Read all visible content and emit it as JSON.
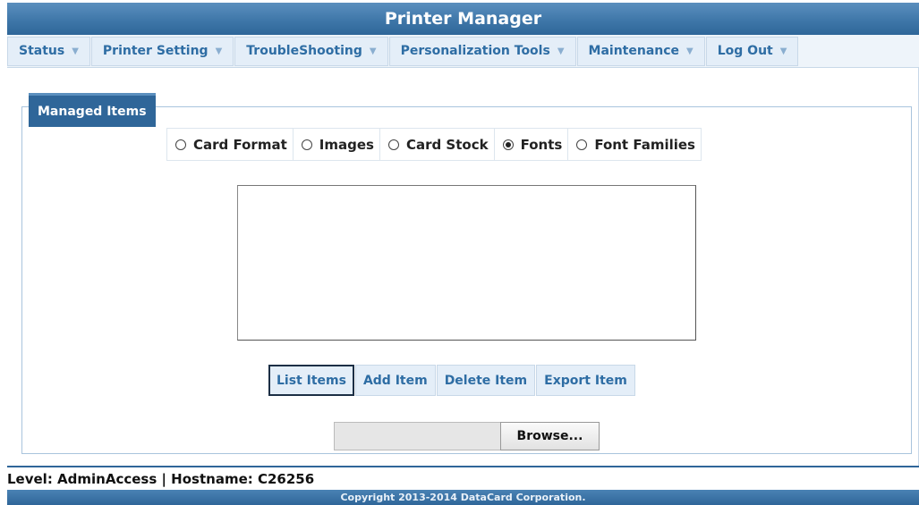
{
  "app_title": "Printer Manager",
  "menu": [
    {
      "label": "Status"
    },
    {
      "label": "Printer Setting"
    },
    {
      "label": "TroubleShooting"
    },
    {
      "label": "Personalization Tools"
    },
    {
      "label": "Maintenance"
    },
    {
      "label": "Log Out"
    }
  ],
  "managed_items": {
    "legend": "Managed Items",
    "options": [
      {
        "label": "Card Format",
        "checked": false
      },
      {
        "label": "Images",
        "checked": false
      },
      {
        "label": "Card Stock",
        "checked": false
      },
      {
        "label": "Fonts",
        "checked": true
      },
      {
        "label": "Font Families",
        "checked": false
      }
    ],
    "buttons": {
      "list": "List Items",
      "add": "Add Item",
      "delete": "Delete Item",
      "export": "Export Item"
    },
    "browse_label": "Browse..."
  },
  "status_line": "Level: AdminAccess | Hostname: C26256",
  "footer": "Copyright 2013-2014 DataCard Corporation.",
  "colors": {
    "header_blue": "#3f77a9",
    "menu_text": "#2e6da4",
    "menu_bg": "#e4eef8"
  }
}
